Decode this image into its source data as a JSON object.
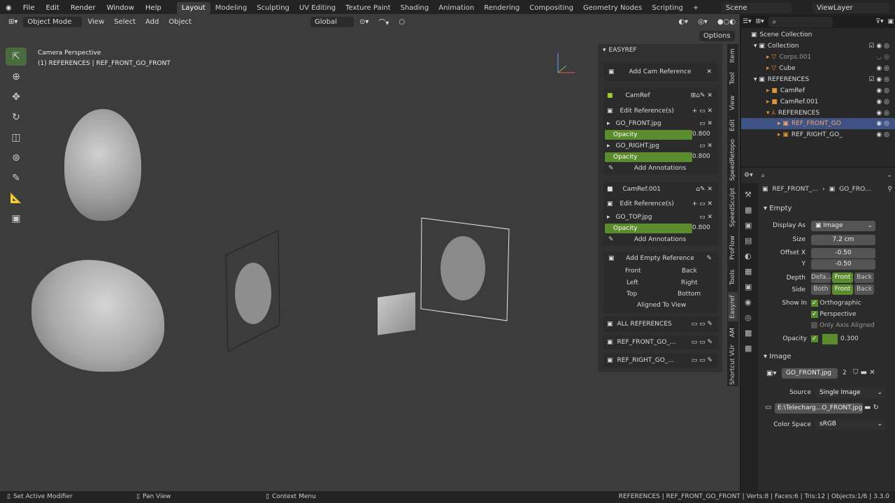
{
  "menu": [
    "File",
    "Edit",
    "Render",
    "Window",
    "Help"
  ],
  "workspaces": [
    "Layout",
    "Modeling",
    "Sculpting",
    "UV Editing",
    "Texture Paint",
    "Shading",
    "Animation",
    "Rendering",
    "Compositing",
    "Geometry Nodes",
    "Scripting"
  ],
  "active_workspace": "Layout",
  "scene": "Scene",
  "view_layer": "ViewLayer",
  "viewport_header": {
    "mode": "Object Mode",
    "view": "View",
    "select": "Select",
    "add": "Add",
    "object": "Object",
    "orientation": "Global",
    "options": "Options"
  },
  "viewport": {
    "title": "Camera Perspective",
    "subtitle": "(1) REFERENCES | REF_FRONT_GO_FRONT"
  },
  "easyref": {
    "title": "EASYREF",
    "add_cam_reference": "Add Cam Reference",
    "camref1": {
      "name": "CamRef",
      "edit": "Edit Reference(s)",
      "img1": "GO_FRONT.jpg",
      "img2": "GO_RIGHT.jpg",
      "opacity_label": "Opacity",
      "opacity1": "0.800",
      "opacity2": "0.800",
      "annot": "Add Annotations"
    },
    "camref2": {
      "name": "CamRef.001",
      "edit": "Edit Reference(s)",
      "img1": "GO_TOP.jpg",
      "opacity_label": "Opacity",
      "opacity1": "0.800",
      "annot": "Add Annotations"
    },
    "empty": {
      "title": "Add Empty Reference",
      "front": "Front",
      "back": "Back",
      "left": "Left",
      "right": "Right",
      "top": "Top",
      "bottom": "Bottom",
      "aligned": "Aligned To View"
    },
    "all_refs": "ALL REFERENCES",
    "ref1": "REF_FRONT_GO_...",
    "ref2": "REF_RIGHT_GO_..."
  },
  "side_tabs": [
    "Item",
    "Tool",
    "View",
    "Edit",
    "SpeedRetopo",
    "SpeedSculpt",
    "ProFlow",
    "Tools",
    "Easyref",
    "AM",
    "Shortcut VUr"
  ],
  "outliner": {
    "rows": [
      {
        "label": "Scene Collection"
      },
      {
        "label": "Collection"
      },
      {
        "label": "Corps.001"
      },
      {
        "label": "Cube"
      },
      {
        "label": "REFERENCES"
      },
      {
        "label": "CamRef"
      },
      {
        "label": "CamRef.001"
      },
      {
        "label": "REFERENCES"
      },
      {
        "label": "REF_FRONT_GO"
      },
      {
        "label": "REF_RIGHT_GO_"
      }
    ]
  },
  "properties": {
    "breadcrumb1": "REF_FRONT_...",
    "breadcrumb2": "GO_FRO...",
    "empty_section": "Empty",
    "display_as_label": "Display As",
    "display_as": "Image",
    "size_label": "Size",
    "size": "7.2 cm",
    "offset_x_label": "Offset X",
    "offset_x": "-0.50",
    "y_label": "Y",
    "offset_y": "-0.50",
    "depth_label": "Depth",
    "depth": [
      "Defa...",
      "Front",
      "Back"
    ],
    "side_label": "Side",
    "side": [
      "Both",
      "Front",
      "Back"
    ],
    "show_in_label": "Show In",
    "ortho": "Orthographic",
    "persp": "Perspective",
    "axis": "Only Axis Aligned",
    "opacity_label": "Opacity",
    "opacity": "0.300",
    "image_section": "Image",
    "image_name": "GO_FRONT.jpg",
    "image_users": "2",
    "source_label": "Source",
    "source": "Single Image",
    "filepath": "E:\\Telecharg...O_FRONT.jpg",
    "colorspace_label": "Color Space",
    "colorspace": "sRGB"
  },
  "status": {
    "left": "Set Active Modifier",
    "mid": "Pan View",
    "right": "Context Menu",
    "info": "REFERENCES | REF_FRONT_GO_FRONT | Verts:8 | Faces:6 | Tris:12 | Objects:1/6 | 3.3.0"
  },
  "colors": {
    "accent": "#5a8b2c",
    "selection": "#3e5384",
    "viewport": "#3c3c3c"
  }
}
